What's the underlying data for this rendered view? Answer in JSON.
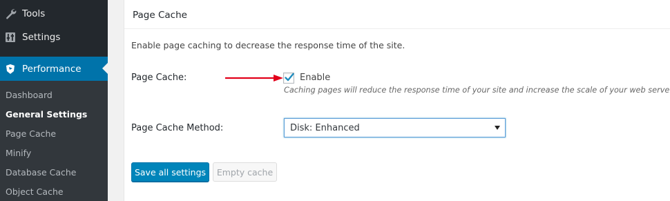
{
  "sidebar": {
    "menu": [
      {
        "label": "Tools",
        "icon": "wrench-icon"
      },
      {
        "label": "Settings",
        "icon": "settings-icon"
      },
      {
        "label": "Performance",
        "icon": "performance-icon"
      }
    ],
    "submenu": [
      {
        "label": "Dashboard"
      },
      {
        "label": "General Settings",
        "current": true
      },
      {
        "label": "Page Cache"
      },
      {
        "label": "Minify"
      },
      {
        "label": "Database Cache"
      },
      {
        "label": "Object Cache"
      }
    ]
  },
  "panel": {
    "title": "Page Cache",
    "intro": "Enable page caching to decrease the response time of the site.",
    "page_cache": {
      "label": "Page Cache:",
      "checkbox_label": "Enable",
      "checked": true,
      "hint": "Caching pages will reduce the response time of your site and increase the scale of your web server."
    },
    "method": {
      "label": "Page Cache Method:",
      "selected": "Disk: Enhanced"
    },
    "buttons": {
      "save": "Save all settings",
      "empty": "Empty cache"
    }
  },
  "colors": {
    "sidebar_bg": "#23282d",
    "submenu_bg": "#32373c",
    "active": "#0073aa",
    "primary_button": "#0085ba",
    "annotation_arrow": "#e2001a"
  }
}
